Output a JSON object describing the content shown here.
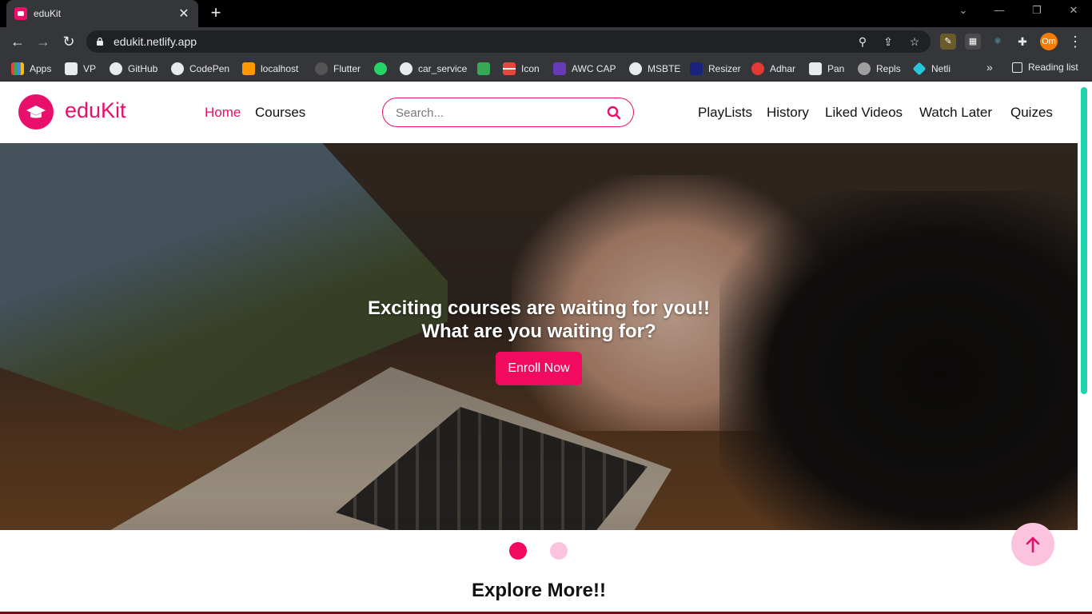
{
  "browser": {
    "tab_title": "eduKit",
    "tab_close": "✕",
    "new_tab": "+",
    "url": "edukit.netlify.app",
    "profile_initials": "Om",
    "bookmarks": [
      {
        "label": "Apps",
        "icon": "apps-grid-icon",
        "color": "#e8453c"
      },
      {
        "label": "VP",
        "icon": "vp-icon",
        "color": "#e8eaed"
      },
      {
        "label": "GitHub",
        "icon": "github-icon",
        "color": "#e8eaed"
      },
      {
        "label": "CodePen",
        "icon": "codepen-icon",
        "color": "#e8eaed"
      },
      {
        "label": "localhost",
        "icon": "localhost-icon",
        "color": "#ff9800"
      },
      {
        "label": "Flutter",
        "icon": "flutter-icon",
        "color": "#555"
      },
      {
        "label": "",
        "icon": "whatsapp-icon",
        "color": "#25d366"
      },
      {
        "label": "car_service",
        "icon": "github-icon",
        "color": "#e8eaed"
      },
      {
        "label": "",
        "icon": "green-grid-icon",
        "color": "#34a853"
      },
      {
        "label": "Icon",
        "icon": "icon-grid-icon",
        "color": "#e8453c"
      },
      {
        "label": "AWC CAP",
        "icon": "awc-icon",
        "color": "#673ab7"
      },
      {
        "label": "MSBTE",
        "icon": "msbte-icon",
        "color": "#e8eaed"
      },
      {
        "label": "Resizer",
        "icon": "resizer-icon",
        "color": "#1a237e"
      },
      {
        "label": "Adhar",
        "icon": "adhar-icon",
        "color": "#e53935"
      },
      {
        "label": "Pan",
        "icon": "pan-icon",
        "color": "#e8eaed"
      },
      {
        "label": "Repls",
        "icon": "repls-icon",
        "color": "#9e9e9e"
      },
      {
        "label": "Netli",
        "icon": "netlify-icon",
        "color": "#26c6da"
      }
    ],
    "bookmarks_more": "»",
    "reading_list": "Reading list"
  },
  "navbar": {
    "brand": "eduKit",
    "links_left": [
      "Home",
      "Courses"
    ],
    "search_placeholder": "Search...",
    "links_right": [
      "PlayLists",
      "History",
      "Liked Videos",
      "Watch Later",
      "Quizes"
    ]
  },
  "hero": {
    "line1": "Exciting courses are waiting for you!!",
    "line2": "What are you waiting for?",
    "cta": "Enroll Now",
    "slide_count": 2,
    "active_slide": 1
  },
  "section": {
    "title": "Explore More!!"
  },
  "colors": {
    "accent": "#e8106b",
    "button": "#f20a5e",
    "dot_inactive": "#fbc3de",
    "scrollbar": "#1fd3b0"
  }
}
